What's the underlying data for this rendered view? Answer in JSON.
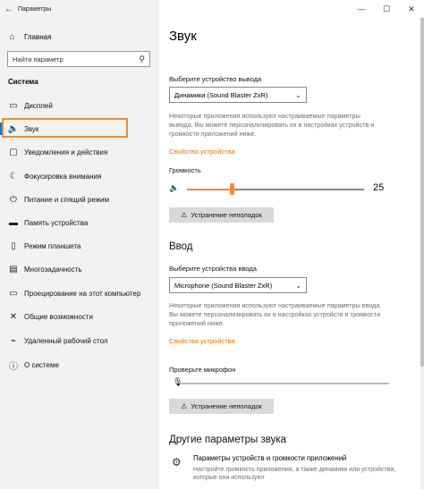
{
  "window": {
    "title": "Параметры",
    "back_icon": "←",
    "controls": {
      "minimize": "—",
      "maximize": "☐",
      "close": "✕"
    }
  },
  "sidebar": {
    "home": {
      "icon": "⌂",
      "label": "Главная"
    },
    "search": {
      "placeholder": "Найти параметр",
      "icon": "⚲"
    },
    "section": "Система",
    "items": [
      {
        "icon": "▭",
        "label": "Дисплей"
      },
      {
        "icon": "🔈",
        "label": "Звук",
        "active": true
      },
      {
        "icon": "▢",
        "label": "Уведомления и действия"
      },
      {
        "icon": "☾",
        "label": "Фокусировка внимания"
      },
      {
        "icon": "⏻",
        "label": "Питание и спящий режим"
      },
      {
        "icon": "▬",
        "label": "Память устройства"
      },
      {
        "icon": "▯",
        "label": "Режим планшета"
      },
      {
        "icon": "▤",
        "label": "Многозадачность"
      },
      {
        "icon": "▭",
        "label": "Проецирование на этот компьютер"
      },
      {
        "icon": "✕",
        "label": "Общие возможности"
      },
      {
        "icon": "⌁",
        "label": "Удаленный рабочий стол"
      },
      {
        "icon": "ⓘ",
        "label": "О системе"
      }
    ]
  },
  "main": {
    "title": "Звук",
    "output": {
      "select_label": "Выберите устройство вывода",
      "device": "Динамики (Sound Blaster ZxR)",
      "description": "Некоторые приложения используют настраиваемые параметры вывода. Вы можете персонализировать их в настройках устройств и громкости приложений ниже.",
      "properties_link": "Свойства устройства",
      "volume_label": "Громкость",
      "volume_value": "25",
      "volume_fraction": 0.25,
      "troubleshoot": "Устранение неполадок"
    },
    "input": {
      "heading": "Ввод",
      "select_label": "Выберите устройства ввода",
      "device": "Microphone (Sound Blaster ZxR)",
      "description": "Некоторые приложения используют настраиваемые параметры ввода. Вы можете персонализировать их в настройках устройств и громкости приложений ниже.",
      "properties_link": "Свойства устройства",
      "mic_label": "Проверьте микрофон",
      "troubleshoot": "Устранение неполадок"
    },
    "other": {
      "heading": "Другие параметры звука",
      "item_title": "Параметры устройств и громкости приложений",
      "item_desc": "Настройте громкость приложения, а также динамики или устройства, которые они используют"
    }
  },
  "colors": {
    "accent": "#f28a30",
    "link": "#e37814",
    "highlight": "#f28a30"
  }
}
